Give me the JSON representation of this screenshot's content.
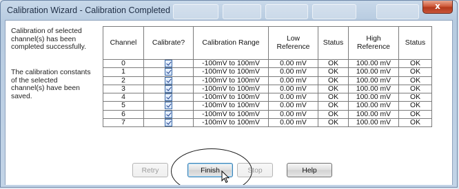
{
  "window": {
    "title": "Calibration Wizard - Calibration Completed",
    "close_label": "x"
  },
  "messages": {
    "completed": "Calibration of selected\nchannel(s) has been\ncompleted successfully.",
    "saved": "The calibration constants\nof the selected\nchannel(s) have been\nsaved."
  },
  "table": {
    "headers": {
      "channel": "Channel",
      "calibrate": "Calibrate?",
      "range": "Calibration Range",
      "low": "Low\nReference",
      "status_low": "Status",
      "high": "High\nReference",
      "status_high": "Status"
    },
    "rows": [
      {
        "channel": "0",
        "checked": true,
        "range": "-100mV to 100mV",
        "low": "0.00 mV",
        "status_low": "OK",
        "high": "100.00 mV",
        "status_high": "OK"
      },
      {
        "channel": "1",
        "checked": true,
        "range": "-100mV to 100mV",
        "low": "0.00 mV",
        "status_low": "OK",
        "high": "100.00 mV",
        "status_high": "OK"
      },
      {
        "channel": "2",
        "checked": true,
        "range": "-100mV to 100mV",
        "low": "0.00 mV",
        "status_low": "OK",
        "high": "100.00 mV",
        "status_high": "OK"
      },
      {
        "channel": "3",
        "checked": true,
        "range": "-100mV to 100mV",
        "low": "0.00 mV",
        "status_low": "OK",
        "high": "100.00 mV",
        "status_high": "OK"
      },
      {
        "channel": "4",
        "checked": true,
        "range": "-100mV to 100mV",
        "low": "0.00 mV",
        "status_low": "OK",
        "high": "100.00 mV",
        "status_high": "OK"
      },
      {
        "channel": "5",
        "checked": true,
        "range": "-100mV to 100mV",
        "low": "0.00 mV",
        "status_low": "OK",
        "high": "100.00 mV",
        "status_high": "OK"
      },
      {
        "channel": "6",
        "checked": true,
        "range": "-100mV to 100mV",
        "low": "0.00 mV",
        "status_low": "OK",
        "high": "100.00 mV",
        "status_high": "OK"
      },
      {
        "channel": "7",
        "checked": true,
        "range": "-100mV to 100mV",
        "low": "0.00 mV",
        "status_low": "OK",
        "high": "100.00 mV",
        "status_high": "OK"
      }
    ]
  },
  "buttons": {
    "retry": "Retry",
    "finish": "Finish",
    "stop": "Stop",
    "help": "Help"
  },
  "icons": {
    "cursor": "arrow-cursor-icon",
    "close": "close-icon"
  }
}
